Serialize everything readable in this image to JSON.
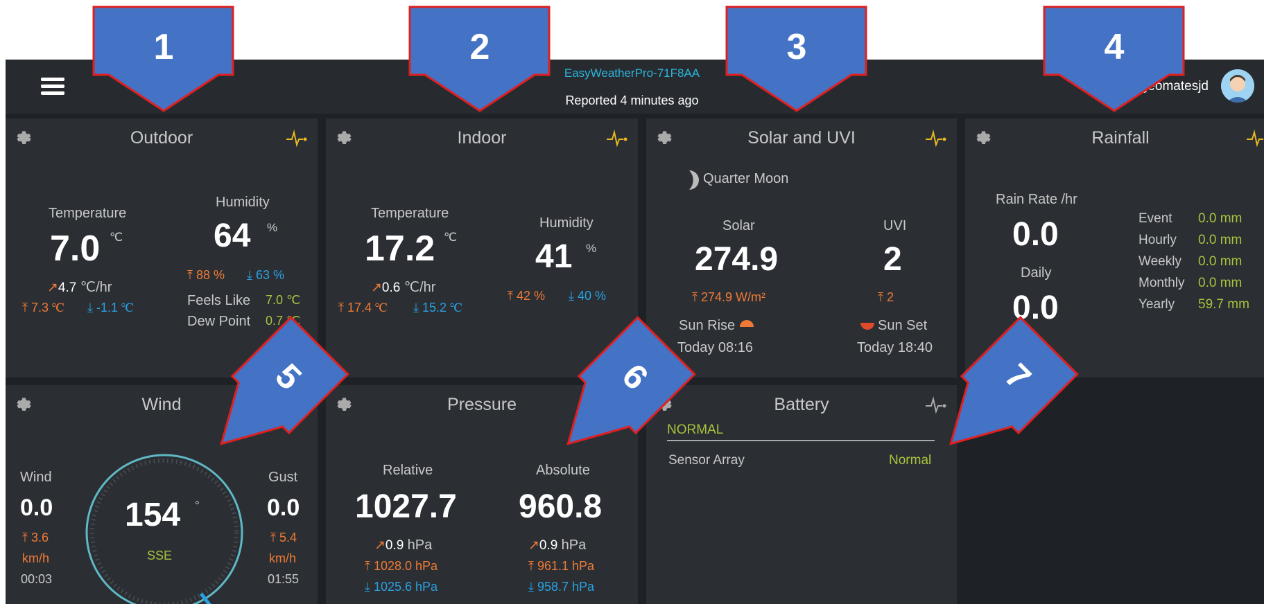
{
  "header": {
    "device": "EasyWeatherPro-71F8AA",
    "reported": "Reported 4 minutes ago",
    "user": "geomatesjd"
  },
  "callouts": [
    "1",
    "2",
    "3",
    "4",
    "5",
    "6",
    "7"
  ],
  "outdoor": {
    "title": "Outdoor",
    "temp_label": "Temperature",
    "temp": "7.0",
    "temp_unit": "℃",
    "temp_rate": "4.7",
    "rate_unit": "℃/hr",
    "temp_hi": "7.3 ℃",
    "temp_lo": "-1.1 ℃",
    "hum_label": "Humidity",
    "hum": "64",
    "hum_unit": "%",
    "hum_hi": "88 %",
    "hum_lo": "63 %",
    "feels_label": "Feels Like",
    "feels": "7.0 ℃",
    "dew_label": "Dew Point",
    "dew": "0.7 ℃"
  },
  "indoor": {
    "title": "Indoor",
    "temp_label": "Temperature",
    "temp": "17.2",
    "temp_unit": "℃",
    "temp_rate": "0.6",
    "rate_unit": "℃/hr",
    "temp_hi": "17.4 ℃",
    "temp_lo": "15.2 ℃",
    "hum_label": "Humidity",
    "hum": "41",
    "hum_unit": "%",
    "hum_hi": "42 %",
    "hum_lo": "40 %"
  },
  "solar": {
    "title": "Solar and UVI",
    "moon": "Quarter Moon",
    "solar_label": "Solar",
    "solar": "274.9",
    "solar_hi": "274.9 W/m²",
    "uvi_label": "UVI",
    "uvi": "2",
    "uvi_hi": "2",
    "sunrise_label": "Sun Rise",
    "sunrise": "Today 08:16",
    "sunset_label": "Sun Set",
    "sunset": "Today 18:40"
  },
  "rain": {
    "title": "Rainfall",
    "rate_label": "Rain Rate /hr",
    "rate": "0.0",
    "daily_label": "Daily",
    "daily": "0.0",
    "rows": [
      {
        "label": "Event",
        "value": "0.0 mm"
      },
      {
        "label": "Hourly",
        "value": "0.0 mm"
      },
      {
        "label": "Weekly",
        "value": "0.0 mm"
      },
      {
        "label": "Monthly",
        "value": "0.0 mm"
      },
      {
        "label": "Yearly",
        "value": "59.7 mm"
      }
    ]
  },
  "wind": {
    "title": "Wind",
    "wind_label": "Wind",
    "wind": "0.0",
    "wind_hi": "3.6",
    "wind_unit": "km/h",
    "wind_time": "00:03",
    "gust_label": "Gust",
    "gust": "0.0",
    "gust_hi": "5.4",
    "gust_unit": "km/h",
    "gust_time": "01:55",
    "dir": "154",
    "dir_unit": "°",
    "dir_name": "SSE"
  },
  "pressure": {
    "title": "Pressure",
    "rel_label": "Relative",
    "rel": "1027.7",
    "rel_rate": "0.9",
    "rel_hi": "1028.0 hPa",
    "rel_lo": "1025.6 hPa",
    "abs_label": "Absolute",
    "abs": "960.8",
    "abs_rate": "0.9",
    "abs_hi": "961.1 hPa",
    "abs_lo": "958.7 hPa",
    "unit": "hPa"
  },
  "battery": {
    "title": "Battery",
    "status": "NORMAL",
    "sensor": "Sensor Array",
    "sensor_status": "Normal"
  },
  "colors": {
    "accent": "#2bb5d9",
    "orange": "#f07a35",
    "blue": "#2aa0e0",
    "green": "#a9c23c",
    "callout": "#4472c4",
    "callout_border": "#e02020"
  }
}
